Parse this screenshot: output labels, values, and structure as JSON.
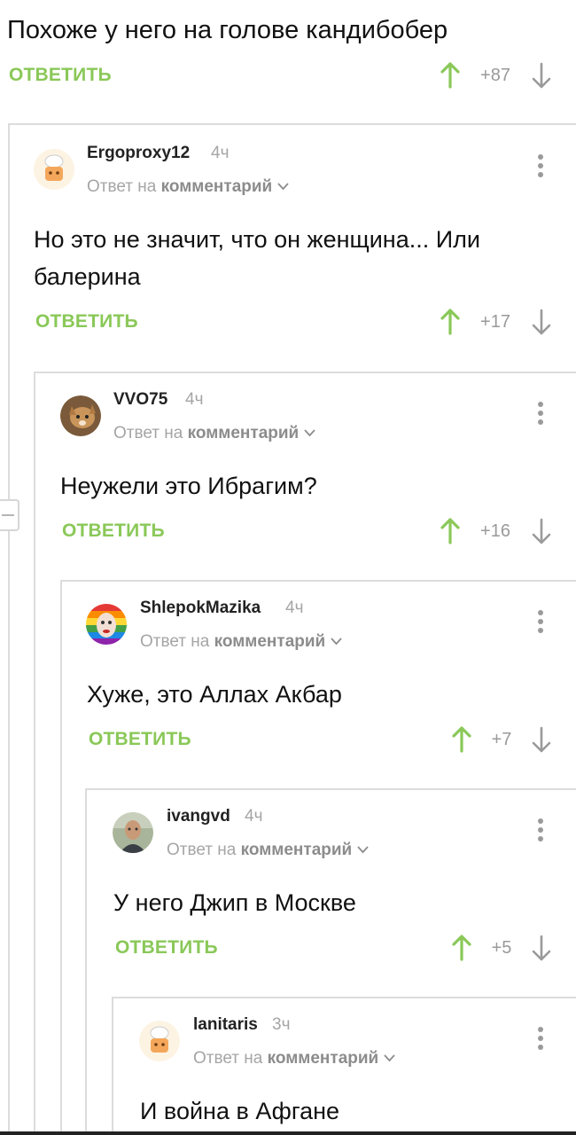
{
  "top": {
    "text": "Похоже у него на голове кандибобер",
    "reply_label": "ОТВЕТИТЬ",
    "votes": "+87"
  },
  "comments": [
    {
      "author": "Ergoproxy12",
      "time": "4ч",
      "reply_prefix": "Ответ на",
      "reply_target": "комментарий",
      "text": "Но это не значит, что он женщина... Или балерина",
      "reply_label": "ОТВЕТИТЬ",
      "votes": "+17",
      "avatar": "chef-hat-avatar"
    },
    {
      "author": "VVO75",
      "time": "4ч",
      "reply_prefix": "Ответ на",
      "reply_target": "комментарий",
      "text": "Неужели это Ибрагим?",
      "reply_label": "ОТВЕТИТЬ",
      "votes": "+16",
      "avatar": "cat-avatar"
    },
    {
      "author": "ShlepokMazika",
      "time": "4ч",
      "reply_prefix": "Ответ на",
      "reply_target": "комментарий",
      "text": "Хуже, это Аллах Акбар",
      "reply_label": "ОТВЕТИТЬ",
      "votes": "+7",
      "avatar": "rainbow-face-avatar"
    },
    {
      "author": "ivangvd",
      "time": "4ч",
      "reply_prefix": "Ответ на",
      "reply_target": "комментарий",
      "text": "У него Джип в Москве",
      "reply_label": "ОТВЕТИТЬ",
      "votes": "+5",
      "avatar": "man-photo-avatar"
    },
    {
      "author": "lanitaris",
      "time": "3ч",
      "reply_prefix": "Ответ на",
      "reply_target": "комментарий",
      "text": "И война в Афгане",
      "avatar": "chef-hat-avatar"
    }
  ],
  "colors": {
    "accent_green": "#8ac858",
    "muted_gray": "#9a9a9a",
    "thread_line": "#dcdcdc"
  }
}
